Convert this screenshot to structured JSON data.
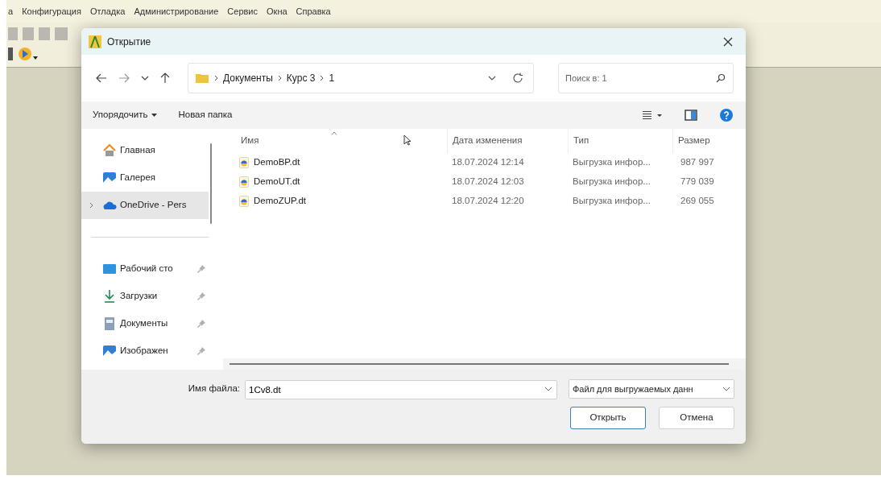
{
  "menu": [
    "а",
    "Конфигурация",
    "Отладка",
    "Администрирование",
    "Сервис",
    "Окна",
    "Справка"
  ],
  "dialog": {
    "title": "Открытие",
    "path": [
      "Документы",
      "Курс 3",
      "1"
    ],
    "search": {
      "placeholder": "Поиск в: 1"
    },
    "commands": [
      {
        "label": "Упорядочить",
        "dropdown": true
      },
      {
        "label": "Новая папка",
        "dropdown": false
      }
    ],
    "sidebar": [
      {
        "label": "Главная",
        "kind": "home",
        "selected": false,
        "pinned": false,
        "expandable": false
      },
      {
        "label": "Галерея",
        "kind": "gallery",
        "selected": false,
        "pinned": false,
        "expandable": false
      },
      {
        "label": "OneDrive - Pers",
        "kind": "cloud",
        "selected": true,
        "pinned": false,
        "expandable": true
      },
      {
        "label": "Рабочий сто",
        "kind": "desktop",
        "selected": false,
        "pinned": true,
        "expandable": false
      },
      {
        "label": "Загрузки",
        "kind": "download",
        "selected": false,
        "pinned": true,
        "expandable": false
      },
      {
        "label": "Документы",
        "kind": "document",
        "selected": false,
        "pinned": true,
        "expandable": false
      },
      {
        "label": "Изображен",
        "kind": "gallery",
        "selected": false,
        "pinned": true,
        "expandable": false
      }
    ],
    "columns": [
      "Имя",
      "Дата изменения",
      "Тип",
      "Размер"
    ],
    "files": [
      {
        "name": "DemoBP.dt",
        "date": "18.07.2024 12:14",
        "type": "Выгрузка инфор...",
        "size": "987 997"
      },
      {
        "name": "DemoUT.dt",
        "date": "18.07.2024 12:03",
        "type": "Выгрузка инфор...",
        "size": "779 039"
      },
      {
        "name": "DemoZUP.dt",
        "date": "18.07.2024 12:20",
        "type": "Выгрузка инфор...",
        "size": "269 055"
      }
    ],
    "filename_label": "Имя файла:",
    "filename": "1Cv8.dt",
    "filter": "Файл для выгружаемых данн",
    "buttons": [
      "Открыть",
      "Отмена"
    ]
  }
}
